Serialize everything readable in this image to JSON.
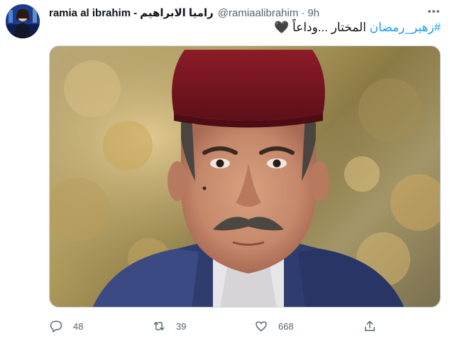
{
  "tweet": {
    "display_name": "ramia al ibrahim",
    "separator": "-",
    "arabic_name": "راميا الابراهيم",
    "handle": "@ramiaalibrahim",
    "dot": "·",
    "time": "9h",
    "text_hashtag": "#زهير_رمضان",
    "text_body": " المختار ...وداعاً ",
    "text_emoji": "🖤",
    "image_alt": "Portrait of a mustached man wearing a red fez in front of autumn foliage"
  },
  "actions": {
    "reply_count": "48",
    "retweet_count": "39",
    "like_count": "668"
  },
  "colors": {
    "accent": "#1d9bf0",
    "muted": "#536471",
    "fez": "#7a1420"
  },
  "icons": [
    "more-icon",
    "reply-icon",
    "retweet-icon",
    "like-icon",
    "share-icon"
  ]
}
